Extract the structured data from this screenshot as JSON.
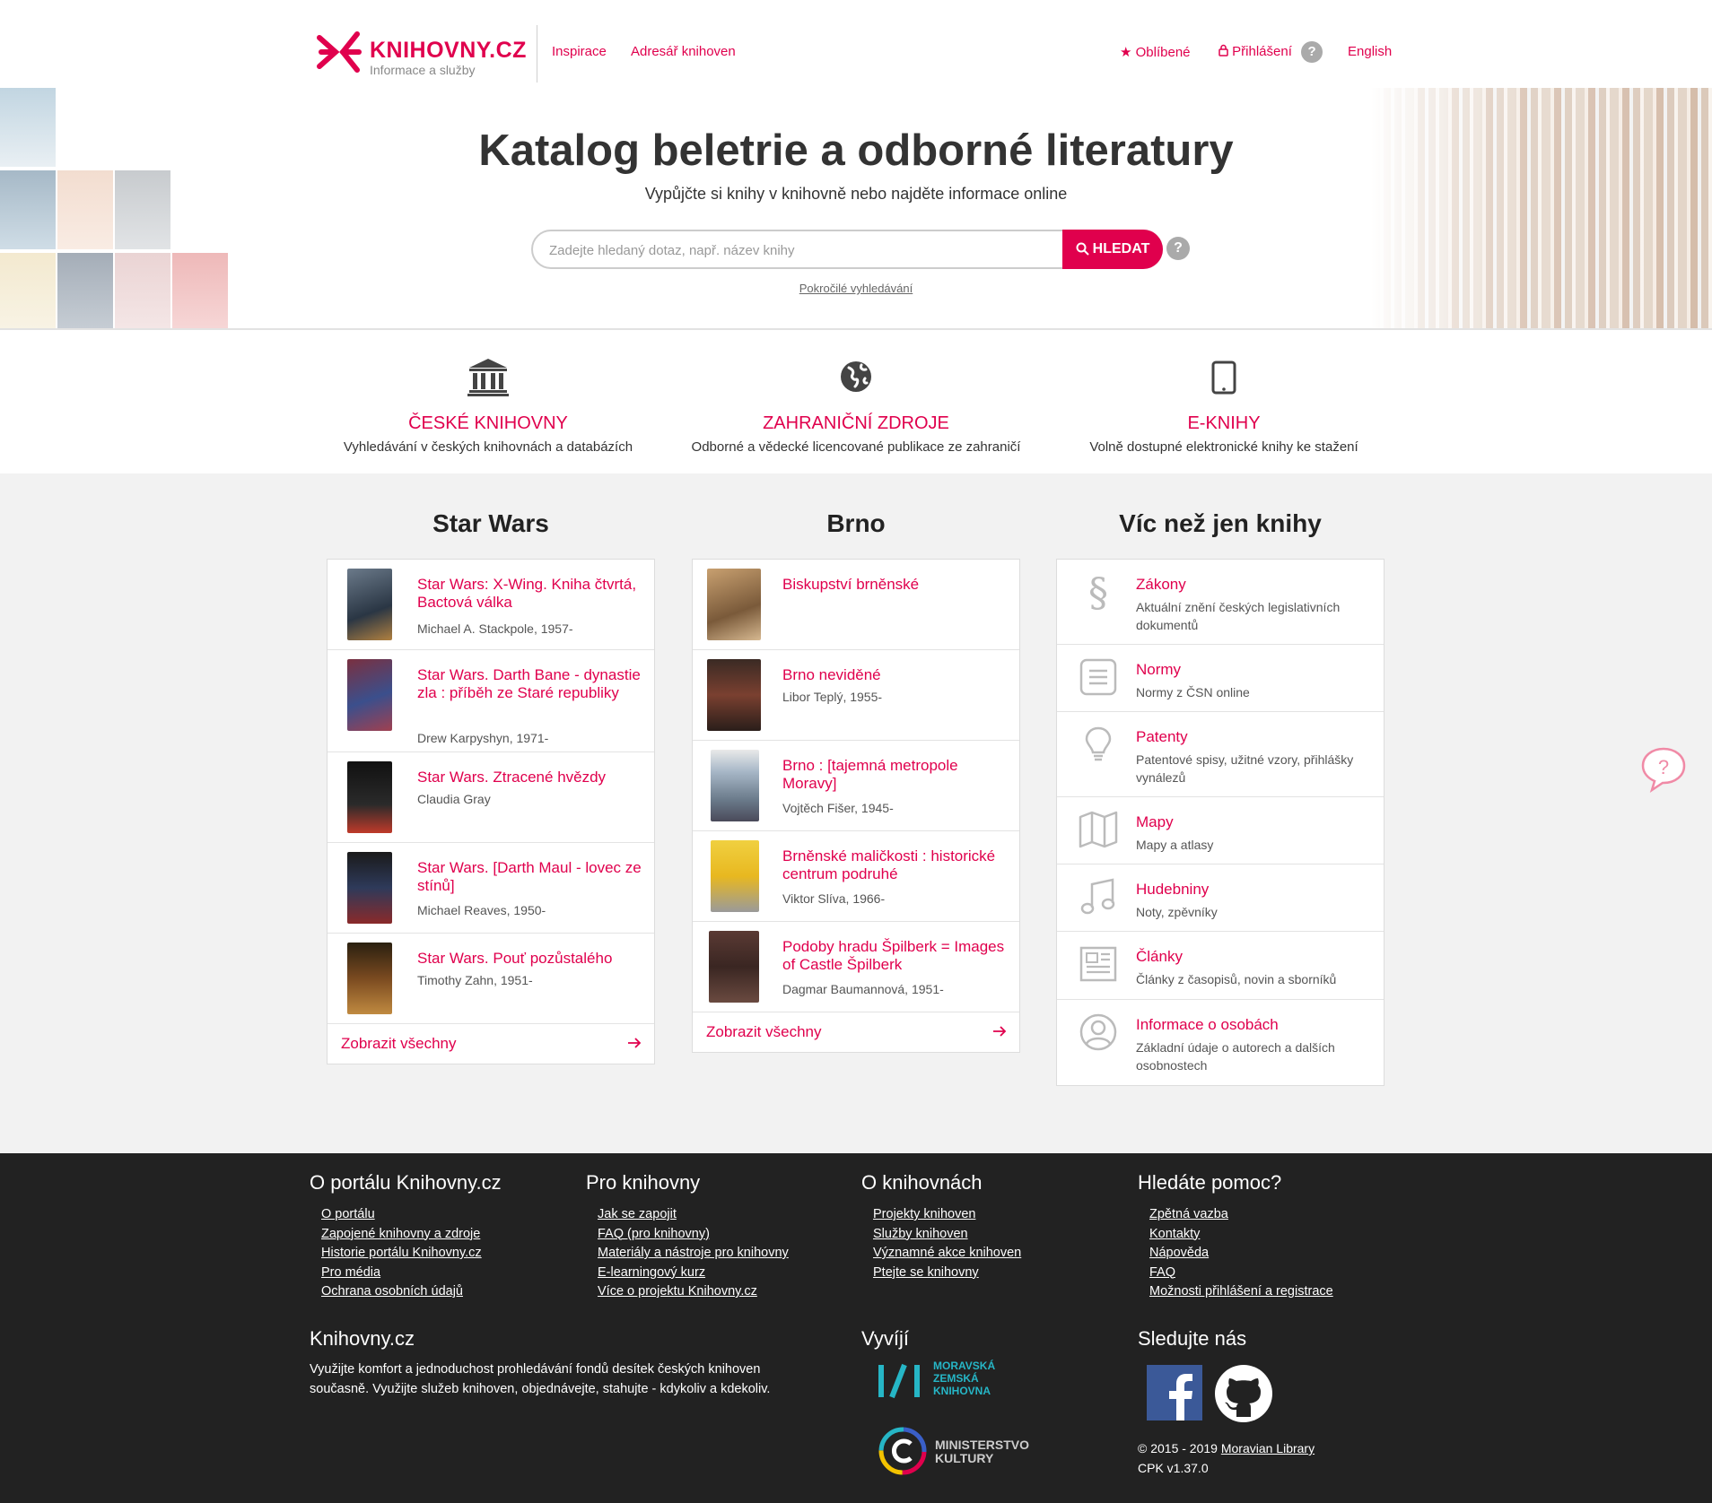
{
  "header": {
    "logo_name": "KNIHOVNY.CZ",
    "logo_sub": "Informace a služby",
    "nav": {
      "inspirace": "Inspirace",
      "adresar": "Adresář knihoven"
    },
    "right": {
      "favorites": "Oblíbené",
      "login": "Přihlášení",
      "login_help": "?",
      "language": "English"
    },
    "title": "Katalog beletrie a odborné literatury",
    "subtitle": "Vypůjčte si knihy v knihovně nebo najděte informace online",
    "search": {
      "placeholder": "Zadejte hledaný dotaz, např. název knihy",
      "button": "HLEDAT",
      "help": "?"
    },
    "advanced": "Pokročilé vyhledávání"
  },
  "categories": [
    {
      "icon": "library-building-icon",
      "title": "ČESKÉ KNIHOVNY",
      "desc": "Vyhledávání v českých knihovnách a databázích"
    },
    {
      "icon": "globe-icon",
      "title": "ZAHRANIČNÍ ZDROJE",
      "desc": "Odborné a vědecké licencované publikace ze zahraničí"
    },
    {
      "icon": "tablet-icon",
      "title": "E-KNIHY",
      "desc": "Volně dostupné elektronické knihy ke stažení"
    }
  ],
  "starwars": {
    "title": "Star Wars",
    "items": [
      {
        "title": "Star Wars: X-Wing. Kniha čtvrtá, Bactová válka",
        "author": "Michael A. Stackpole, 1957-"
      },
      {
        "title": "Star Wars. Darth Bane - dynastie zla : příběh ze Staré republiky",
        "author": "Drew Karpyshyn, 1971-"
      },
      {
        "title": "Star Wars. Ztracené hvězdy",
        "author": "Claudia Gray"
      },
      {
        "title": "Star Wars. [Darth Maul - lovec ze stínů]",
        "author": "Michael Reaves, 1950-"
      },
      {
        "title": "Star Wars. Pouť pozůstalého",
        "author": "Timothy Zahn, 1951-"
      }
    ],
    "show_all": "Zobrazit všechny"
  },
  "brno": {
    "title": "Brno",
    "items": [
      {
        "title": "Biskupství brněnské",
        "author": ""
      },
      {
        "title": "Brno neviděné",
        "author": "Libor Teplý, 1955-"
      },
      {
        "title": "Brno : [tajemná metropole Moravy]",
        "author": "Vojtěch Fišer, 1945-"
      },
      {
        "title": "Brněnské maličkosti : historické centrum podruhé",
        "author": "Viktor Slíva, 1966-"
      },
      {
        "title": "Podoby hradu Špilberk = Images of Castle Špilberk",
        "author": "Dagmar Baumannová, 1951-"
      }
    ],
    "show_all": "Zobrazit všechny"
  },
  "more": {
    "title": "Víc než jen knihy",
    "items": [
      {
        "icon": "paragraph-icon",
        "title": "Zákony",
        "desc": "Aktuální znění českých legislativních dokumentů"
      },
      {
        "icon": "document-icon",
        "title": "Normy",
        "desc": "Normy z ČSN online"
      },
      {
        "icon": "lightbulb-icon",
        "title": "Patenty",
        "desc": "Patentové spisy, užitné vzory, přihlášky vynálezů"
      },
      {
        "icon": "map-icon",
        "title": "Mapy",
        "desc": "Mapy a atlasy"
      },
      {
        "icon": "music-note-icon",
        "title": "Hudebniny",
        "desc": "Noty, zpěvníky"
      },
      {
        "icon": "newspaper-icon",
        "title": "Články",
        "desc": "Články z časopisů, novin a sborníků"
      },
      {
        "icon": "person-icon",
        "title": "Informace o osobách",
        "desc": "Základní údaje o autorech a dalších osobnostech"
      }
    ]
  },
  "footer": {
    "about": {
      "title": "O portálu Knihovny.cz",
      "links": [
        "O portálu",
        "Zapojené knihovny a zdroje",
        "Historie portálu Knihovny.cz",
        "Pro média",
        "Ochrana osobních údajů"
      ]
    },
    "for_libraries": {
      "title": "Pro knihovny",
      "links": [
        "Jak se zapojit",
        "FAQ (pro knihovny)",
        "Materiály a nástroje pro knihovny",
        "E-learningový kurz",
        "Více o projektu Knihovny.cz"
      ]
    },
    "about_libraries": {
      "title": "O knihovnách",
      "links": [
        "Projekty knihoven",
        "Služby knihoven",
        "Významné akce knihoven",
        "Ptejte se knihovny"
      ]
    },
    "help": {
      "title": "Hledáte pomoc?",
      "links": [
        "Zpětná vazba",
        "Kontakty",
        "Nápověda",
        "FAQ",
        "Možnosti přihlášení a registrace"
      ]
    },
    "brand": {
      "title": "Knihovny.cz",
      "text": "Využijte komfort a jednoduchost prohledávání fondů desítek českých knihoven současně. Využijte služeb knihoven, objednávejte, stahujte - kdykoliv a kdekoliv."
    },
    "developed": {
      "title": "Vyvíjí",
      "mzk": [
        "MORAVSKÁ",
        "ZEMSKÁ",
        "KNIHOVNA"
      ],
      "mk": [
        "MINISTERSTVO",
        "KULTURY"
      ]
    },
    "follow": {
      "title": "Sledujte nás"
    },
    "copyright": "© 2015 - 2019",
    "copyright_link": "Moravian Library",
    "version": "CPK v1.37.0"
  },
  "colors": {
    "accent": "#e0004d",
    "footer_bg": "#222222",
    "main_bg": "#f2f2f2"
  }
}
